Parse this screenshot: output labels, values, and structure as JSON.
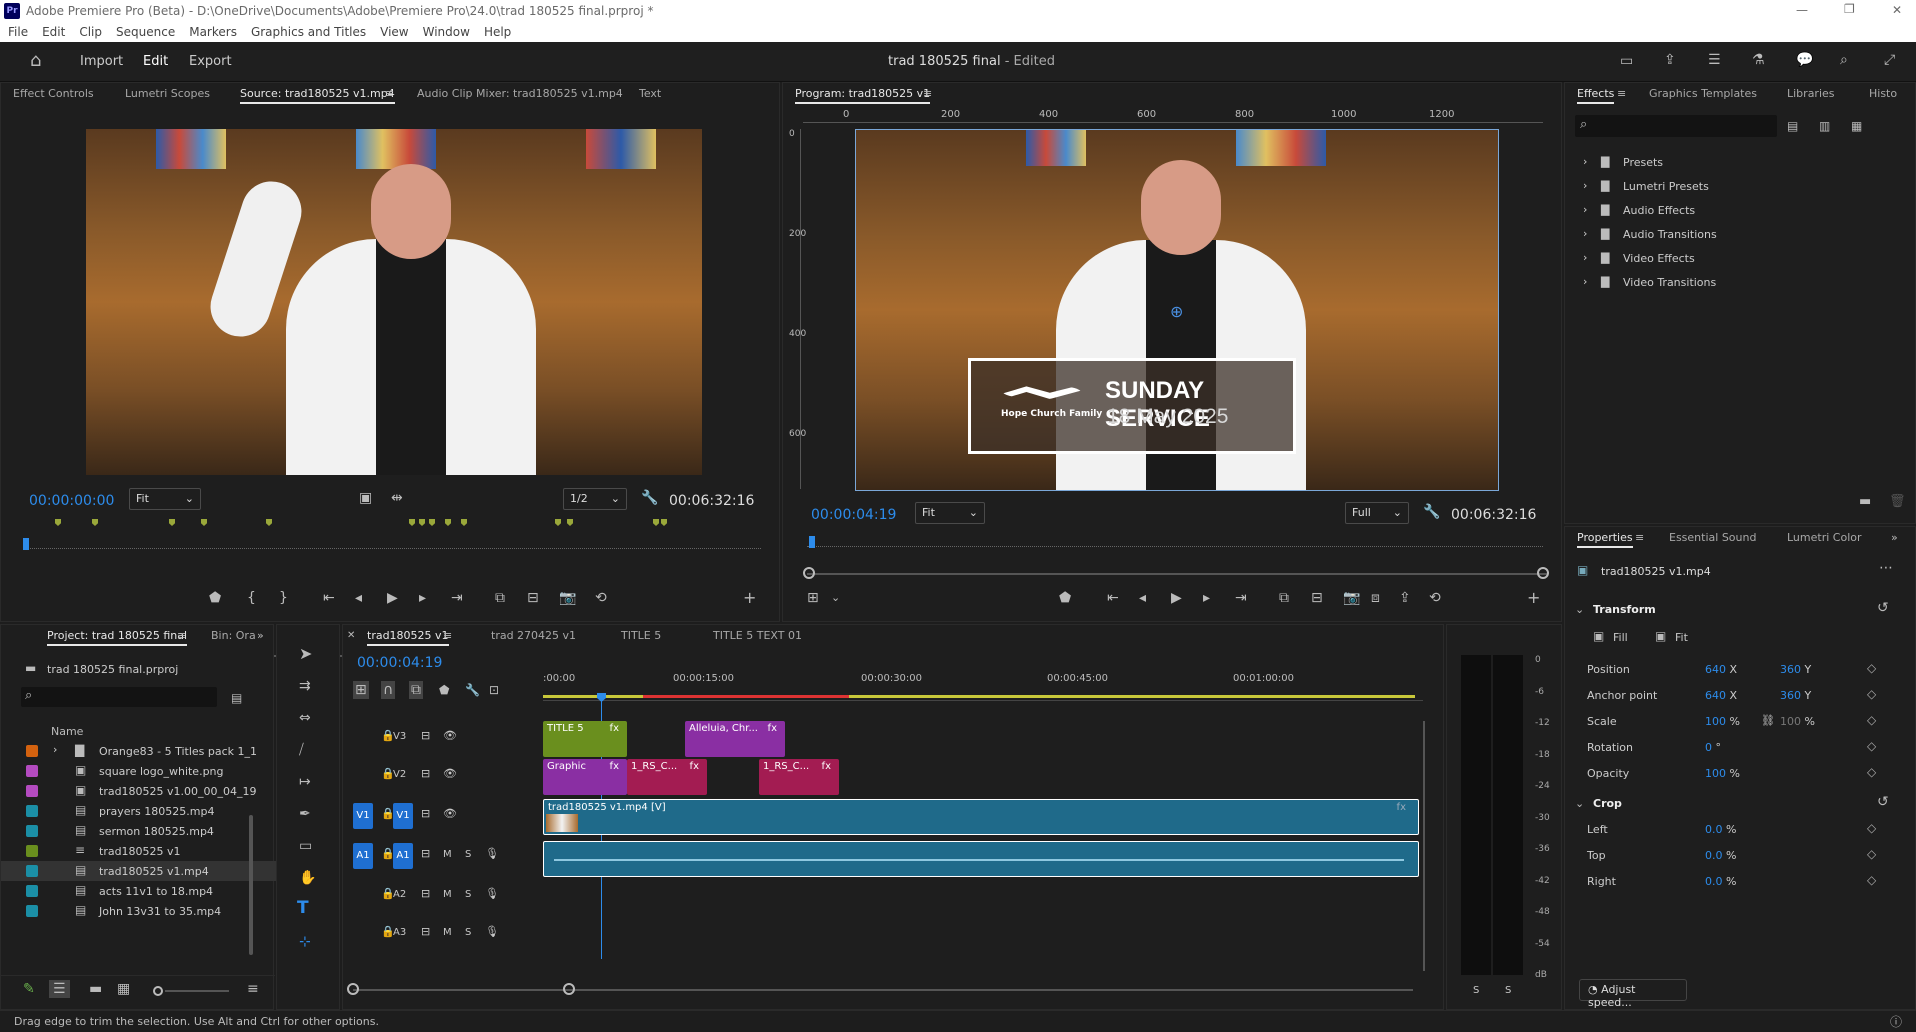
{
  "app": {
    "title": "Adobe Premiere Pro (Beta) - D:\\OneDrive\\Documents\\Adobe\\Premiere Pro\\24.0\\trad 180525 final.prproj *",
    "menu": [
      "File",
      "Edit",
      "Clip",
      "Sequence",
      "Markers",
      "Graphics and Titles",
      "View",
      "Window",
      "Help"
    ],
    "window_controls": {
      "minimize": "—",
      "restore": "❐",
      "close": "✕"
    }
  },
  "workspace": {
    "nav": [
      "Import",
      "Edit",
      "Export"
    ],
    "active": "Edit",
    "doc_title": "trad 180525 final",
    "doc_state": "- Edited"
  },
  "source_panel": {
    "tabs": [
      "Effect Controls",
      "Lumetri Scopes",
      "Source: trad180525 v1.mp4",
      "Audio Clip Mixer: trad180525 v1.mp4",
      "Text"
    ],
    "active_tab": "Source: trad180525 v1.mp4",
    "timecode": "00:00:00:00",
    "zoom": "Fit",
    "resolution": "1/2",
    "duration": "00:06:32:16"
  },
  "program_panel": {
    "title": "Program: trad180525 v1",
    "ruler": [
      "0",
      "200",
      "400",
      "600",
      "800",
      "1000",
      "1200"
    ],
    "vruler": [
      "0",
      "200",
      "400",
      "600"
    ],
    "timecode": "00:00:04:19",
    "zoom": "Fit",
    "resolution": "Full",
    "duration": "00:06:32:16",
    "overlay_title": "SUNDAY SERVICE",
    "overlay_date": "18 May 2025",
    "overlay_logo": "Hope Church Family"
  },
  "effects_panel": {
    "tabs": [
      "Effects",
      "Graphics Templates",
      "Libraries",
      "Histo"
    ],
    "active_tab": "Effects",
    "search_placeholder": "",
    "items": [
      "Presets",
      "Lumetri Presets",
      "Audio Effects",
      "Audio Transitions",
      "Video Effects",
      "Video Transitions"
    ]
  },
  "properties_panel": {
    "tabs": [
      "Properties",
      "Essential Sound",
      "Lumetri Color"
    ],
    "active_tab": "Properties",
    "clip": "trad180525 v1.mp4",
    "transform": {
      "title": "Transform",
      "fill": "Fill",
      "fit": "Fit",
      "rows": [
        {
          "label": "Position",
          "v1": "640",
          "u1": "X",
          "v2": "360",
          "u2": "Y"
        },
        {
          "label": "Anchor point",
          "v1": "640",
          "u1": "X",
          "v2": "360",
          "u2": "Y"
        },
        {
          "label": "Scale",
          "v1": "100",
          "u1": "%",
          "v2": "100",
          "u2": "%"
        },
        {
          "label": "Rotation",
          "v1": "0",
          "u1": "°",
          "v2": "",
          "u2": ""
        },
        {
          "label": "Opacity",
          "v1": "100",
          "u1": "%",
          "v2": "",
          "u2": ""
        }
      ]
    },
    "crop": {
      "title": "Crop",
      "rows": [
        {
          "label": "Left",
          "v1": "0.0",
          "u1": "%"
        },
        {
          "label": "Top",
          "v1": "0.0",
          "u1": "%"
        },
        {
          "label": "Right",
          "v1": "0.0",
          "u1": "%"
        }
      ]
    },
    "adjust_button": "Adjust speed..."
  },
  "project_panel": {
    "tabs": [
      "Project: trad 180525 final",
      "Bin: Ora"
    ],
    "file": "trad 180525 final.prproj",
    "column": "Name",
    "items": [
      {
        "name": "Orange83 - 5 Titles pack 1_1",
        "color": "#d4620f",
        "kind": "folder"
      },
      {
        "name": "square logo_white.png",
        "color": "#b44bc0",
        "kind": "image"
      },
      {
        "name": "trad180525 v1.00_00_04_19",
        "color": "#b44bc0",
        "kind": "image"
      },
      {
        "name": "prayers 180525.mp4",
        "color": "#1b8fa6",
        "kind": "video"
      },
      {
        "name": "sermon 180525.mp4",
        "color": "#1b8fa6",
        "kind": "video"
      },
      {
        "name": "trad180525 v1",
        "color": "#6a8f1e",
        "kind": "sequence"
      },
      {
        "name": "trad180525 v1.mp4",
        "color": "#1b8fa6",
        "kind": "video",
        "selected": true
      },
      {
        "name": "acts 11v1 to 18.mp4",
        "color": "#1b8fa6",
        "kind": "video"
      },
      {
        "name": "John 13v31 to 35.mp4",
        "color": "#1b8fa6",
        "kind": "video"
      }
    ]
  },
  "timeline": {
    "tabs": [
      "trad180525 v1",
      "trad 270425 v1",
      "TITLE 5",
      "TITLE 5 TEXT 01"
    ],
    "active_tab": "trad180525 v1",
    "timecode": "00:00:04:19",
    "ruler": [
      ":00:00",
      "00:00:15:00",
      "00:00:30:00",
      "00:00:45:00",
      "00:01:00:00"
    ],
    "tracks": [
      {
        "id": "V3",
        "target": ""
      },
      {
        "id": "V2",
        "target": ""
      },
      {
        "id": "V1",
        "target": "V1"
      },
      {
        "id": "A1",
        "target": "A1"
      },
      {
        "id": "A2",
        "target": ""
      },
      {
        "id": "A3",
        "target": ""
      }
    ],
    "track_btn_m": "M",
    "track_btn_s": "S",
    "clips": {
      "v3": [
        {
          "label": "TITLE 5",
          "fx": "fx"
        },
        {
          "label": "Alleluia, Chr...",
          "fx": "fx"
        }
      ],
      "v2": [
        {
          "label": "Graphic",
          "fx": "fx"
        },
        {
          "label": "1_RS_C...",
          "fx": "fx"
        },
        {
          "label": "1_RS_C...",
          "fx": "fx"
        }
      ],
      "v1": {
        "label": "trad180525 v1.mp4 [V]",
        "fx": "fx"
      }
    }
  },
  "audio_meter": {
    "scale": [
      "0",
      "-6",
      "-12",
      "-18",
      "-24",
      "-30",
      "-36",
      "-42",
      "-48",
      "-54",
      "dB"
    ],
    "solo": [
      "S",
      "S"
    ]
  },
  "statusbar": {
    "text": "Drag edge to trim the selection. Use Alt and Ctrl for other options."
  }
}
